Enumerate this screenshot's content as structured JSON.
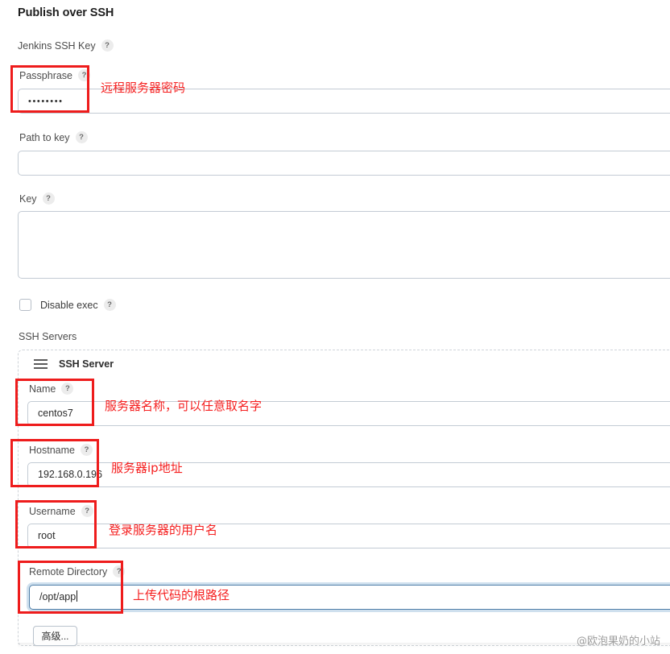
{
  "section": {
    "title": "Publish over SSH"
  },
  "fields": {
    "jenkins_ssh_key_label": "Jenkins SSH Key",
    "passphrase_label": "Passphrase",
    "passphrase_value": "••••••••",
    "path_to_key_label": "Path to key",
    "path_to_key_value": "",
    "key_label": "Key",
    "key_value": "",
    "disable_exec_label": "Disable exec",
    "disable_exec_checked": false,
    "ssh_servers_label": "SSH Servers",
    "help_glyph": "?"
  },
  "ssh_server": {
    "panel_title": "SSH Server",
    "name_label": "Name",
    "name_value": "centos7",
    "hostname_label": "Hostname",
    "hostname_value": "192.168.0.196",
    "username_label": "Username",
    "username_value": "root",
    "remote_directory_label": "Remote Directory",
    "remote_directory_value": "/opt/app",
    "advanced_button_label": "高级..."
  },
  "annotations": [
    {
      "text": "远程服务器密码"
    },
    {
      "text": "服务器名称，可以任意取名字"
    },
    {
      "text": "服务器ip地址"
    },
    {
      "text": "登录服务器的用户名"
    },
    {
      "text": "上传代码的根路径"
    }
  ],
  "watermark": {
    "text": "@欧泡果奶的小站"
  },
  "colors": {
    "annotation_red": "#ee1c1c",
    "focus_blue": "#4f7ea8",
    "border_gray": "#c3cbd4"
  }
}
